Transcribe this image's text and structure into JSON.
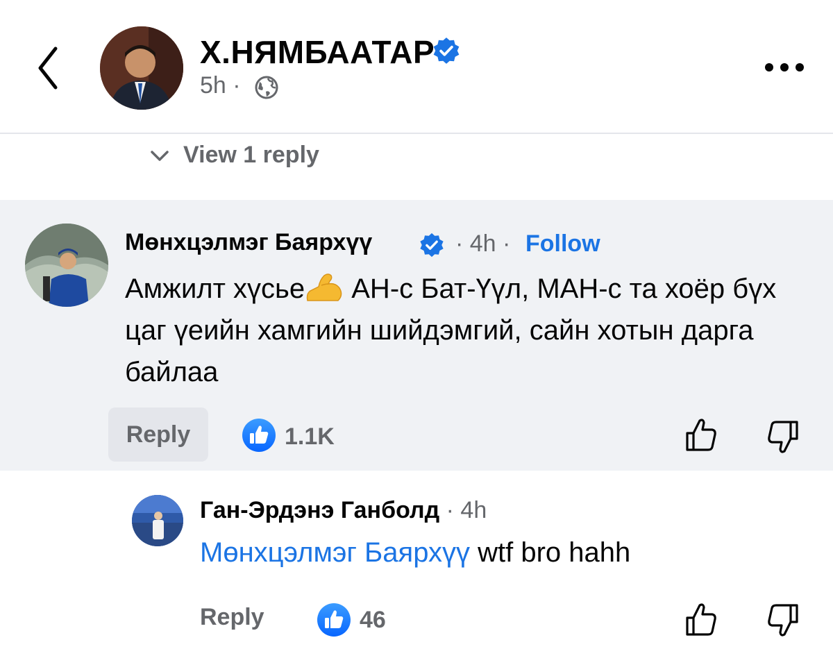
{
  "header": {
    "author_name": "Х.НЯМБААТАР",
    "post_time": "5h ·",
    "icons": {
      "back": "chevron-left-icon",
      "verified": "verified-badge-icon",
      "audience": "globe-icon",
      "more": "more-horizontal-icon"
    }
  },
  "thread": {
    "view_replies_label": "View 1 reply"
  },
  "comment": {
    "author": "Мөнхцэлмэг Баярхүү",
    "time": "· 4h ·",
    "follow_label": "Follow",
    "text_before_emoji": "Амжилт хүсье",
    "emoji": "flexed-biceps-emoji",
    "text_after_emoji": " АН-с Бат-Үүл, МАН-с та хоёр бүх цаг үеийн хамгийн шийдэмгий, сайн хотын дарга байлаа",
    "reply_label": "Reply",
    "like_count": "1.1K"
  },
  "reply": {
    "author": "Ган-Эрдэнэ Ганболд",
    "time": " · 4h",
    "mention": "Мөнхцэлмэг Баярхүү",
    "text": " wtf bro hahh",
    "reply_label": "Reply",
    "like_count": "46"
  },
  "colors": {
    "accent": "#1b74e4",
    "secondary_text": "#65676b",
    "highlight_bg": "#f0f2f5",
    "button_bg": "#e4e6eb"
  }
}
